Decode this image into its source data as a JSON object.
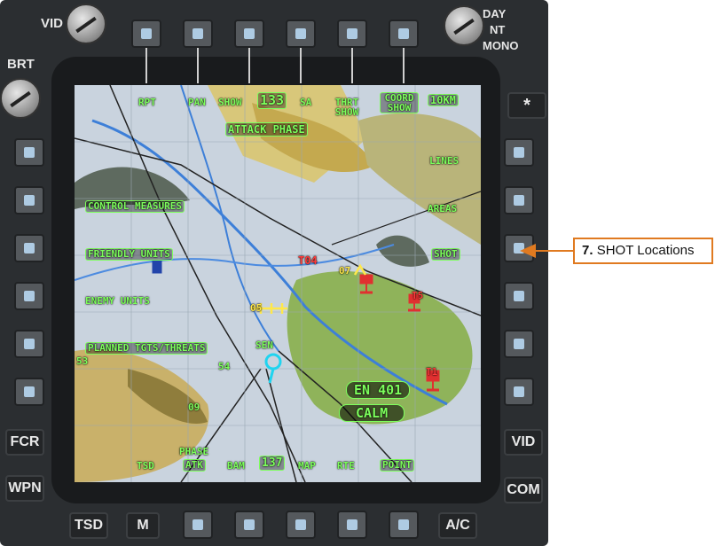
{
  "bezel": {
    "knob_left": "VID",
    "knob_brightness": "BRT",
    "knob_mode": [
      "DAY",
      "NT",
      "MONO"
    ],
    "asterisk": "*",
    "left_fixed": [
      "FCR",
      "WPN"
    ],
    "right_fixed": [
      "VID",
      "COM"
    ],
    "bottom_fixed": [
      "TSD",
      "M",
      "A/C"
    ]
  },
  "screen": {
    "top_row": [
      "RPT",
      "PAN",
      "SHOW",
      "133",
      "SA",
      "THRT SHOW",
      "COORD SHOW",
      "10KM"
    ],
    "phase_title": "ATTACK PHASE",
    "left_labels": [
      "CONTROL MEASURES",
      "FRIENDLY UNITS",
      "ENEMY UNITS",
      "PLANNED TGTS/THREATS"
    ],
    "right_labels": [
      "LINES",
      "AREAS",
      "SHOT"
    ],
    "bottom_row": [
      "TSD",
      "PHASE",
      "ATK",
      "BAM",
      "137",
      "MAP",
      "RTE",
      "POINT"
    ],
    "status": [
      "EN 401",
      "CALM"
    ],
    "map_labels": [
      "T04",
      "07",
      "05",
      "SEN",
      "54",
      "09",
      "53",
      "T5",
      "T1"
    ]
  },
  "callout": {
    "number": "7.",
    "text": "SHOT Locations"
  },
  "colors": {
    "symbology": "#7dff5c",
    "bezel": "#2b2e31",
    "callout_border": "#e07a20",
    "threat": "#e03030",
    "friendly": "#ffe84a",
    "ownship": "#1fd4f0"
  }
}
